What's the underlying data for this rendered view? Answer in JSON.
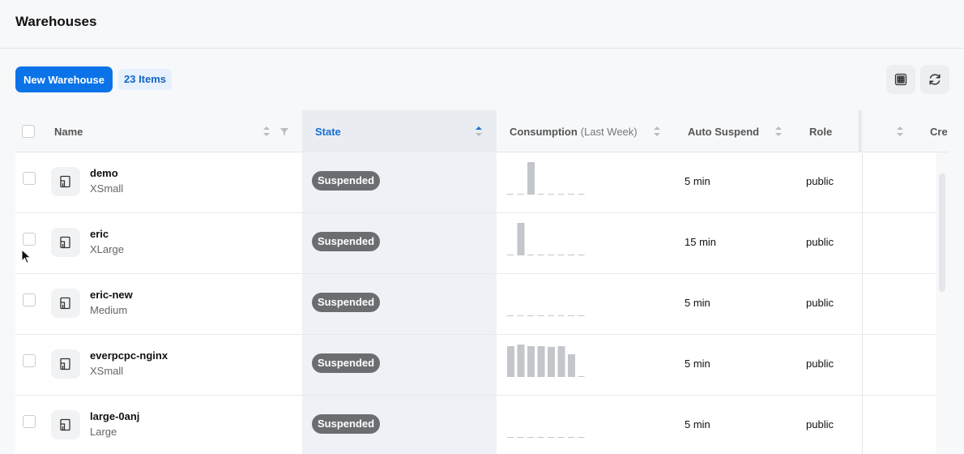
{
  "header": {
    "title": "Warehouses"
  },
  "toolbar": {
    "new_label": "New Warehouse",
    "items_count": "23 Items",
    "grid_icon": "grid-icon",
    "refresh_icon": "refresh-icon"
  },
  "columns": {
    "name": "Name",
    "state": "State",
    "consumption": "Consumption",
    "consumption_note": "(Last Week)",
    "auto_suspend": "Auto Suspend",
    "role": "Role",
    "created": "Cre"
  },
  "rows": [
    {
      "name": "demo",
      "size": "XSmall",
      "state": "Suspended",
      "auto_suspend": "5 min",
      "role": "public",
      "consumption": [
        0,
        0,
        1,
        0,
        0,
        0,
        0,
        0
      ]
    },
    {
      "name": "eric",
      "size": "XLarge",
      "state": "Suspended",
      "auto_suspend": "15 min",
      "role": "public",
      "consumption": [
        0,
        1,
        0,
        0,
        0,
        0,
        0,
        0
      ]
    },
    {
      "name": "eric-new",
      "size": "Medium",
      "state": "Suspended",
      "auto_suspend": "5 min",
      "role": "public",
      "consumption": [
        0,
        0,
        0,
        0,
        0,
        0,
        0,
        0
      ]
    },
    {
      "name": "everpcpc-nginx",
      "size": "XSmall",
      "state": "Suspended",
      "auto_suspend": "5 min",
      "role": "public",
      "consumption": [
        0.95,
        1,
        0.95,
        0.95,
        0.93,
        0.95,
        0.7,
        0
      ]
    },
    {
      "name": "large-0anj",
      "size": "Large",
      "state": "Suspended",
      "auto_suspend": "5 min",
      "role": "public",
      "consumption": [
        0,
        0,
        0,
        0,
        0,
        0,
        0,
        0
      ]
    }
  ],
  "colors": {
    "accent": "#0b73e8",
    "badge": "#6b6d70",
    "spark": "#c3c6ca"
  }
}
